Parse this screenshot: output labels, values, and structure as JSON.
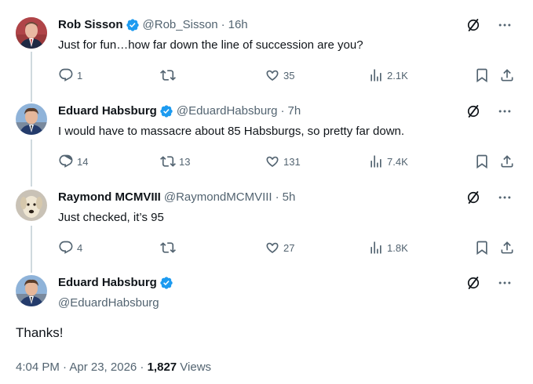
{
  "tweets": [
    {
      "name": "Rob Sisson",
      "handle": "@Rob_Sisson",
      "time": "16h",
      "text": "Just for fun…how far down the line of succession are you?",
      "replies": "1",
      "retweets": "",
      "likes": "35",
      "views": "2.1K"
    },
    {
      "name": "Eduard Habsburg",
      "handle": "@EduardHabsburg",
      "time": "7h",
      "text": "I would have to massacre about 85 Habsburgs, so pretty far down.",
      "replies": "14",
      "retweets": "13",
      "likes": "131",
      "views": "7.4K"
    },
    {
      "name": "Raymond MCMVIII",
      "handle": "@RaymondMCMVIII",
      "time": "5h",
      "text": "Just checked, it’s 95",
      "replies": "4",
      "retweets": "",
      "likes": "27",
      "views": "1.8K"
    }
  ],
  "main_tweet": {
    "name": "Eduard Habsburg",
    "handle": "@EduardHabsburg",
    "text": "Thanks!",
    "timestamp": "4:04 PM · Apr 23, 2026 · ",
    "views_count": "1,827",
    "views_label": " Views"
  },
  "separator": "·",
  "icons": {
    "verified": "verified-badge-icon",
    "grok": "grok-icon",
    "more": "more-icon",
    "reply": "reply-icon",
    "retweet": "retweet-icon",
    "like": "like-icon",
    "views": "views-icon",
    "bookmark": "bookmark-icon",
    "share": "share-icon"
  },
  "colors": {
    "verified": "#1d9bf0",
    "text": "#0f1419",
    "secondary": "#536471",
    "thread_line": "#cfd9de"
  }
}
